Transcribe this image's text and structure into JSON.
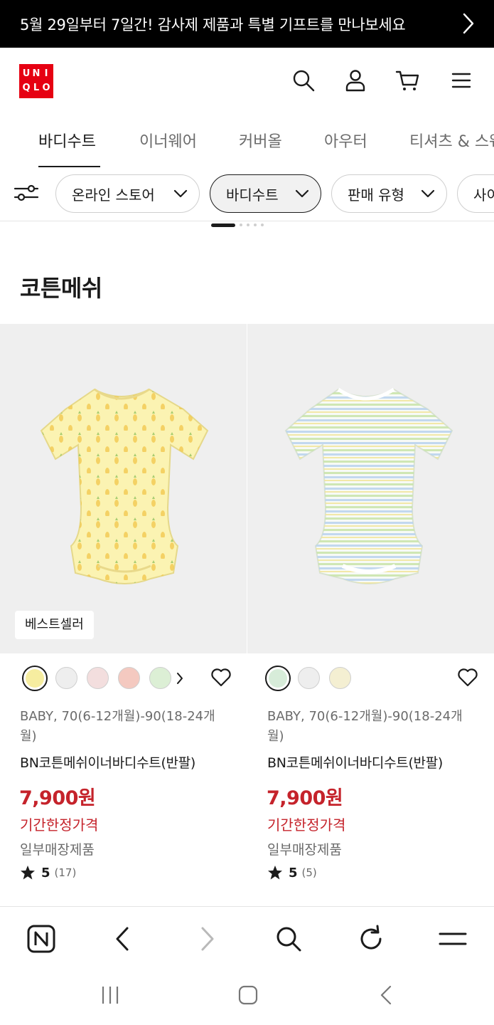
{
  "promo": {
    "text": "5월 29일부터 7일간! 감사제 제품과 특별 기프트를 만나보세요",
    "icon": "chevron-right-icon"
  },
  "header": {
    "logo_letters": [
      "U",
      "N",
      "I",
      "Q",
      "L",
      "O"
    ],
    "icons": [
      "search-icon",
      "account-icon",
      "cart-icon",
      "menu-icon"
    ],
    "brand_color": "#e60012"
  },
  "category_tabs": [
    {
      "label": "바디수트",
      "active": true
    },
    {
      "label": "이너웨어"
    },
    {
      "label": "커버올"
    },
    {
      "label": "아우터"
    },
    {
      "label": "티셔츠 & 스웨"
    }
  ],
  "filters": {
    "icon": "filter-sliders-icon",
    "chips": [
      {
        "label": "온라인 스토어"
      },
      {
        "label": "바디수트",
        "selected": true
      },
      {
        "label": "판매 유형"
      },
      {
        "label": "사이"
      }
    ]
  },
  "section_title": "코튼메쉬",
  "products": [
    {
      "badge": "베스트셀러",
      "swatch_colors": [
        "#f6eda0",
        "#eeeeee",
        "#f3dede",
        "#f4c9c0",
        "#dcefd5"
      ],
      "has_more_swatches": true,
      "gender_size": "BABY, 70(6-12개월)-90(18-24개월)",
      "name": "BN코튼메쉬이너바디수트(반팔)",
      "price": "7,900원",
      "price_note": "기간한정가격",
      "availability": "일부매장제품",
      "rating_score": "5",
      "rating_count": "(17)"
    },
    {
      "badge": "",
      "swatch_colors": [
        "#d7ecd9",
        "#eeeeee",
        "#f4efd2"
      ],
      "has_more_swatches": false,
      "gender_size": "BABY, 70(6-12개월)-90(18-24개월)",
      "name": "BN코튼메쉬이너바디수트(반팔)",
      "price": "7,900원",
      "price_note": "기간한정가격",
      "availability": "일부매장제품",
      "rating_score": "5",
      "rating_count": "(5)"
    }
  ],
  "browser_bar": {
    "icons": [
      "naver-home-icon",
      "back-icon",
      "forward-icon",
      "search-icon",
      "refresh-icon",
      "menu-icon"
    ]
  },
  "system_nav": {
    "icons": [
      "recent-apps-icon",
      "home-icon",
      "back-icon"
    ]
  },
  "colors": {
    "price_red": "#c5232b",
    "text": "#1b1b1b",
    "muted": "#6b6b6b"
  }
}
